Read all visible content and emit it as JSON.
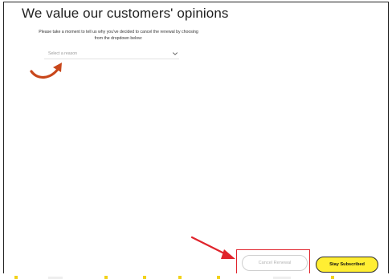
{
  "page": {
    "title": "We value our customers' opinions",
    "instruction": "Please take a moment to tell us why you've decided to cancel the renewal by choosing from the dropdown below:"
  },
  "reason_select": {
    "placeholder": "Select a reason"
  },
  "buttons": {
    "cancel_label": "Cancel Renewal",
    "stay_label": "Stay Subscribed"
  },
  "colors": {
    "stay_button": "#ffee33",
    "highlight_box": "#e0242c",
    "pointer_arrow": "#e0242c",
    "curved_arrow": "#c8471b"
  },
  "icons": {
    "dropdown": "chevron-down-icon",
    "annotation_1": "curved-arrow-icon",
    "annotation_2": "pointer-arrow-icon"
  }
}
